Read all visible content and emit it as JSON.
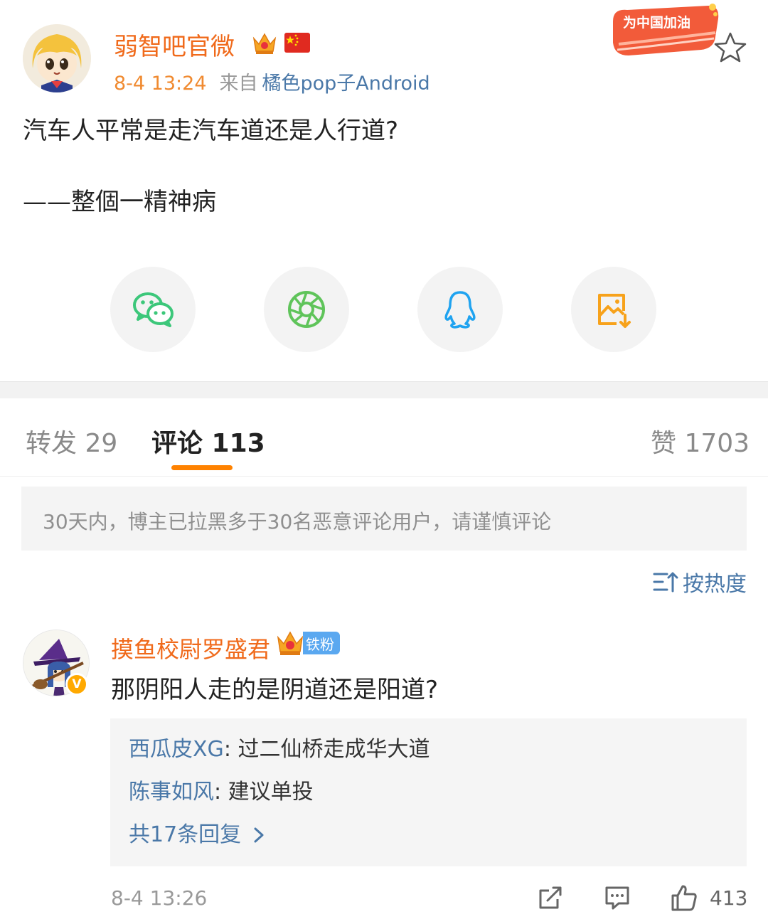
{
  "post": {
    "author": "弱智吧官微",
    "time": "8-4 13:24",
    "from_label": "来自",
    "source": "橘色pop子Android",
    "promo_badge": "为中国加油",
    "lines": [
      "汽车人平常是走汽车道还是人行道?",
      "——整個一精神病"
    ]
  },
  "share": [
    "wechat-icon",
    "moments-icon",
    "qq-icon",
    "save-image-icon"
  ],
  "tabs": {
    "repost": "转发 29",
    "comment": "评论 113",
    "likes": "赞 1703"
  },
  "notice": "30天内，博主已拉黑多于30名恶意评论用户，请谨慎评论",
  "sort_label": "按热度",
  "comment": {
    "author": "摸鱼校尉罗盛君",
    "fan_tag": "铁粉",
    "verified_mark": "V",
    "text": "那阴阳人走的是阴道还是阳道?",
    "replies": [
      {
        "name": "西瓜皮XG",
        "text": ": 过二仙桥走成华大道"
      },
      {
        "name": "陈事如风",
        "text": ": 建议单投"
      }
    ],
    "more_replies": "共17条回复",
    "time": "8-4 13:26",
    "like_count": "413"
  },
  "colors": {
    "brand_orange": "#f06a1b",
    "link_blue": "#4a78a8",
    "tab_indicator": "#ff8200"
  }
}
